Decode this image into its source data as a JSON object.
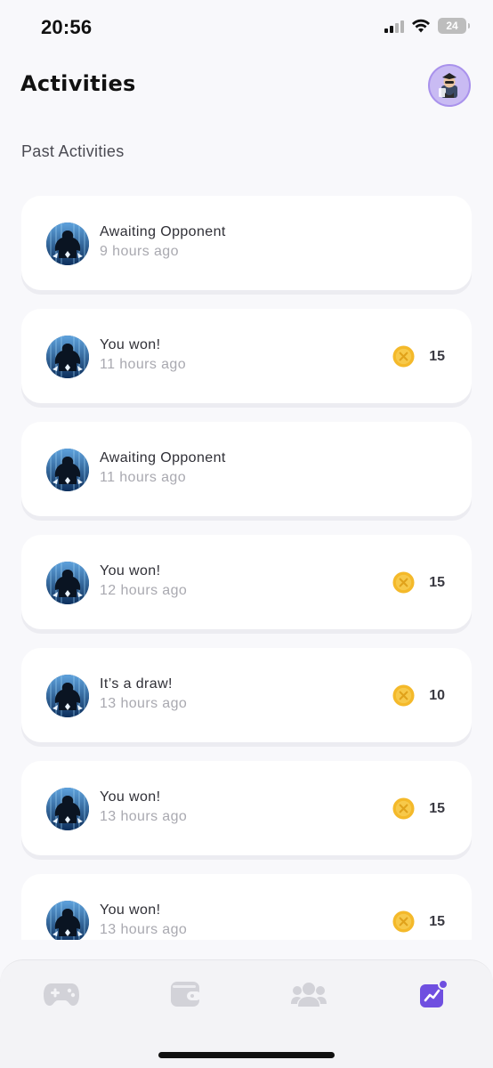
{
  "status_bar": {
    "time": "20:56",
    "battery": "24"
  },
  "header": {
    "title": "Activities"
  },
  "section": {
    "heading": "Past Activities"
  },
  "activities": [
    {
      "title": "Awaiting Opponent",
      "time": "9 hours ago",
      "reward": null
    },
    {
      "title": "You won!",
      "time": "11 hours ago",
      "reward": "15"
    },
    {
      "title": "Awaiting Opponent",
      "time": "11 hours ago",
      "reward": null
    },
    {
      "title": "You won!",
      "time": "12 hours ago",
      "reward": "15"
    },
    {
      "title": "It’s a draw!",
      "time": "13 hours ago",
      "reward": "10"
    },
    {
      "title": "You won!",
      "time": "13 hours ago",
      "reward": "15"
    },
    {
      "title": "You won!",
      "time": "13 hours ago",
      "reward": "15"
    }
  ],
  "tabs": [
    {
      "icon": "gamepad-icon",
      "active": false
    },
    {
      "icon": "wallet-icon",
      "active": false
    },
    {
      "icon": "friends-icon",
      "active": false
    },
    {
      "icon": "activity-chart-icon",
      "active": true,
      "has_badge": true
    }
  ],
  "colors": {
    "accent": "#6f4fe0",
    "coin": "#f4b92a",
    "tab_inactive": "#d2d2d8",
    "card_background": "#ffffff",
    "page_background": "#f8f8fb"
  }
}
